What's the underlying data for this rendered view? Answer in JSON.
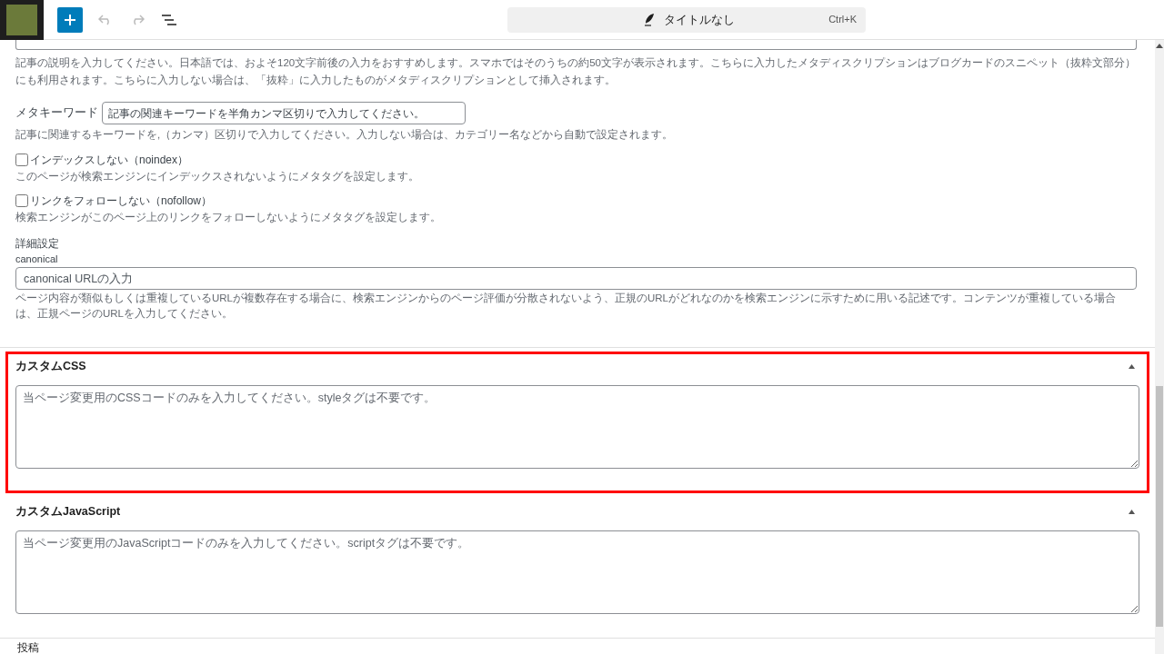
{
  "toolbar": {
    "command_bar": {
      "title": "タイトルなし",
      "shortcut": "Ctrl+K"
    }
  },
  "meta_description": {
    "help": "記事の説明を入力してください。日本語では、およそ120文字前後の入力をおすすめします。スマホではそのうちの約50文字が表示されます。こちらに入力したメタディスクリプションはブログカードのスニペット（抜粋文部分）にも利用されます。こちらに入力しない場合は、「抜粋」に入力したものがメタディスクリプションとして挿入されます。"
  },
  "meta_keywords": {
    "label": "メタキーワード",
    "placeholder": "記事の関連キーワードを半角カンマ区切りで入力してください。",
    "help": "記事に関連するキーワードを,（カンマ）区切りで入力してください。入力しない場合は、カテゴリー名などから自動で設定されます。"
  },
  "options": [
    {
      "label": "インデックスしない（noindex）",
      "checked": false,
      "help": "このページが検索エンジンにインデックスされないようにメタタグを設定します。"
    },
    {
      "label": "リンクをフォローしない（nofollow）",
      "checked": false,
      "help": "検索エンジンがこのページ上のリンクをフォローしないようにメタタグを設定します。"
    }
  ],
  "advanced": {
    "heading": "詳細設定",
    "canonical_label": "canonical",
    "placeholder": "canonical URLの入力",
    "help": "ページ内容が類似もしくは重複しているURLが複数存在する場合に、検索エンジンからのページ評価が分散されないよう、正規のURLがどれなのかを検索エンジンに示すために用いる記述です。コンテンツが重複している場合は、正規ページのURLを入力してください。"
  },
  "panels": [
    {
      "title": "カスタムCSS",
      "expanded": true,
      "highlighted": true,
      "placeholder": "当ページ変更用のCSSコードのみを入力してください。styleタグは不要です。"
    },
    {
      "title": "カスタムJavaScript",
      "expanded": true,
      "highlighted": false,
      "placeholder": "当ページ変更用のJavaScriptコードのみを入力してください。scriptタグは不要です。"
    }
  ],
  "footer": {
    "breadcrumb": "投稿"
  }
}
